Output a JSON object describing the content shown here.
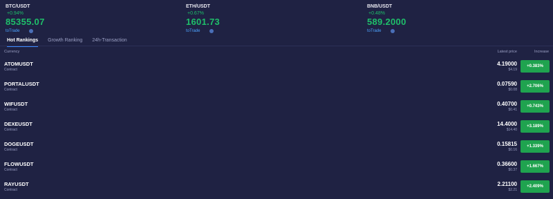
{
  "tickers": [
    {
      "pair": "BTC/USDT",
      "change": "+0.94%",
      "price": "85355.07",
      "trade": "toTrade"
    },
    {
      "pair": "ETH/USDT",
      "change": "+0.67%",
      "price": "1601.73",
      "trade": "toTrade"
    },
    {
      "pair": "BNB/USDT",
      "change": "+0.48%",
      "price": "589.2000",
      "trade": "toTrade"
    }
  ],
  "tabs": [
    "Hot Rankings",
    "Growth Ranking",
    "24h-Transaction"
  ],
  "columns": {
    "currency": "Currency",
    "latest": "Latest price",
    "increase": "Increase"
  },
  "rows": [
    {
      "symbol": "ATOMUSDT",
      "type": "Contract",
      "price": "4.19000",
      "usd": "$4.19",
      "increase": "+0.383%"
    },
    {
      "symbol": "PORTALUSDT",
      "type": "Contract",
      "price": "0.07590",
      "usd": "$0.08",
      "increase": "+2.706%"
    },
    {
      "symbol": "WIFUSDT",
      "type": "Contract",
      "price": "0.40700",
      "usd": "$0.41",
      "increase": "+0.743%"
    },
    {
      "symbol": "DEXEUSDT",
      "type": "Contract",
      "price": "14.4000",
      "usd": "$14.40",
      "increase": "+3.189%"
    },
    {
      "symbol": "DOGEUSDT",
      "type": "Contract",
      "price": "0.15815",
      "usd": "$0.16",
      "increase": "+1.339%"
    },
    {
      "symbol": "FLOWUSDT",
      "type": "Contract",
      "price": "0.36600",
      "usd": "$0.37",
      "increase": "+1.667%"
    },
    {
      "symbol": "RAYUSDT",
      "type": "Contract",
      "price": "2.21100",
      "usd": "$2.21",
      "increase": "+2.409%"
    }
  ],
  "colors": {
    "background": "#1f2243",
    "up": "#1fbf6a",
    "badge": "#1fa34f",
    "accent": "#3d8bff",
    "link": "#4da3ff"
  }
}
